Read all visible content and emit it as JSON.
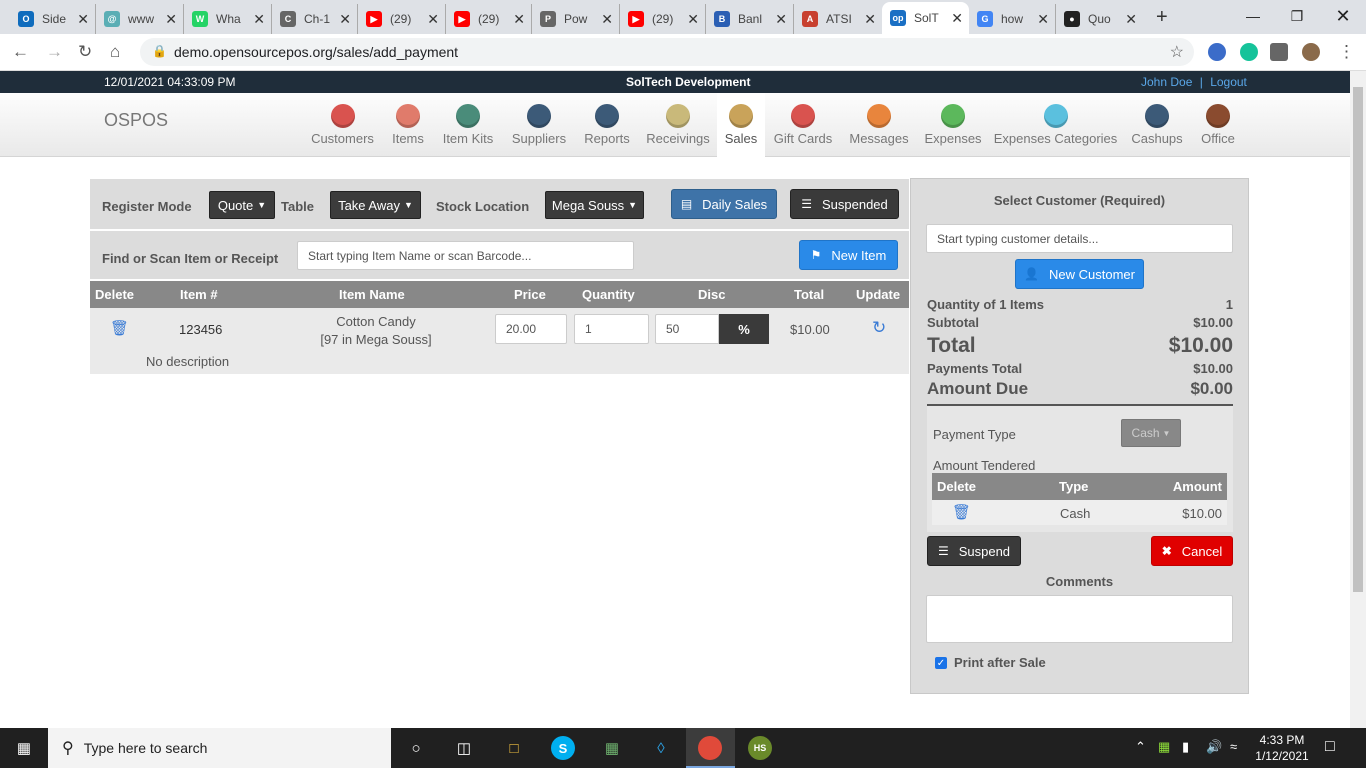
{
  "browser": {
    "tabs": [
      {
        "title": "Side",
        "color": "#0f6cbd",
        "glyph": "O"
      },
      {
        "title": "www",
        "color": "#5aaeb5",
        "glyph": "@"
      },
      {
        "title": "Wha",
        "color": "#25d366",
        "glyph": "W"
      },
      {
        "title": "Ch-1",
        "color": "#666666",
        "glyph": "C"
      },
      {
        "title": "(29)",
        "color": "#ff0000",
        "glyph": "▶"
      },
      {
        "title": "(29)",
        "color": "#ff0000",
        "glyph": "▶"
      },
      {
        "title": "Pow",
        "color": "#666666",
        "glyph": "P"
      },
      {
        "title": "(29)",
        "color": "#ff0000",
        "glyph": "▶"
      },
      {
        "title": "Banl",
        "color": "#2b5fb4",
        "glyph": "B"
      },
      {
        "title": "ATSI",
        "color": "#c8402f",
        "glyph": "A"
      },
      {
        "title": "SolT",
        "color": "#1a6fc4",
        "glyph": "op"
      },
      {
        "title": "how",
        "color": "#4285f4",
        "glyph": "G"
      },
      {
        "title": "Quo",
        "color": "#222222",
        "glyph": "●"
      }
    ],
    "url": "demo.opensourcepos.org/sales/add_payment"
  },
  "topbar": {
    "datetime": "12/01/2021 04:33:09 PM",
    "company": "SolTech Development",
    "user": "John Doe",
    "sep": "|",
    "logout": "Logout"
  },
  "nav": {
    "brand": "OSPOS",
    "items": [
      {
        "label": "Customers",
        "color": "#d9534f"
      },
      {
        "label": "Items",
        "color": "#e07b6b"
      },
      {
        "label": "Item Kits",
        "color": "#4a8c7a"
      },
      {
        "label": "Suppliers",
        "color": "#3c5a78"
      },
      {
        "label": "Reports",
        "color": "#3c5a78"
      },
      {
        "label": "Receivings",
        "color": "#c9b97a"
      },
      {
        "label": "Sales",
        "color": "#c9a35a"
      },
      {
        "label": "Gift Cards",
        "color": "#d9534f"
      },
      {
        "label": "Messages",
        "color": "#e8853d"
      },
      {
        "label": "Expenses",
        "color": "#5cb85c"
      },
      {
        "label": "Expenses Categories",
        "color": "#5bc0de"
      },
      {
        "label": "Cashups",
        "color": "#3c5a78"
      },
      {
        "label": "Office",
        "color": "#8a4b2f"
      }
    ]
  },
  "register": {
    "mode_label": "Register Mode",
    "mode_value": "Quote",
    "table_label": "Table",
    "table_value": "Take Away",
    "stock_label": "Stock Location",
    "stock_value": "Mega Souss",
    "daily_sales": "Daily Sales",
    "suspended": "Suspended",
    "find_label": "Find or Scan Item or Receipt",
    "find_placeholder": "Start typing Item Name or scan Barcode...",
    "new_item": "New Item"
  },
  "cart": {
    "headers": [
      "Delete",
      "Item #",
      "Item Name",
      "Price",
      "Quantity",
      "Disc",
      "Total",
      "Update"
    ],
    "rows": [
      {
        "item_no": "123456",
        "name": "Cotton Candy",
        "stock": "[97 in Mega Souss]",
        "price": "20.00",
        "quantity": "1",
        "discount": "50",
        "disc_type": "%",
        "total": "$10.00",
        "description": "No description"
      }
    ]
  },
  "customer": {
    "title": "Select Customer (Required)",
    "placeholder": "Start typing customer details...",
    "new_customer": "New Customer"
  },
  "summary": {
    "quantity_label": "Quantity of 1 Items",
    "quantity_value": "1",
    "subtotal_label": "Subtotal",
    "subtotal_value": "$10.00",
    "total_label": "Total",
    "total_value": "$10.00",
    "payments_label": "Payments Total",
    "payments_value": "$10.00",
    "due_label": "Amount Due",
    "due_value": "$0.00"
  },
  "payment": {
    "type_label": "Payment Type",
    "type_value": "Cash",
    "tendered_label": "Amount Tendered",
    "headers": [
      "Delete",
      "Type",
      "Amount"
    ],
    "rows": [
      {
        "type": "Cash",
        "amount": "$10.00"
      }
    ]
  },
  "actions": {
    "suspend": "Suspend",
    "cancel": "Cancel",
    "comments_label": "Comments",
    "print_label": "Print after Sale"
  },
  "taskbar": {
    "search_placeholder": "Type here to search",
    "time": "4:33 PM",
    "date": "1/12/2021"
  }
}
